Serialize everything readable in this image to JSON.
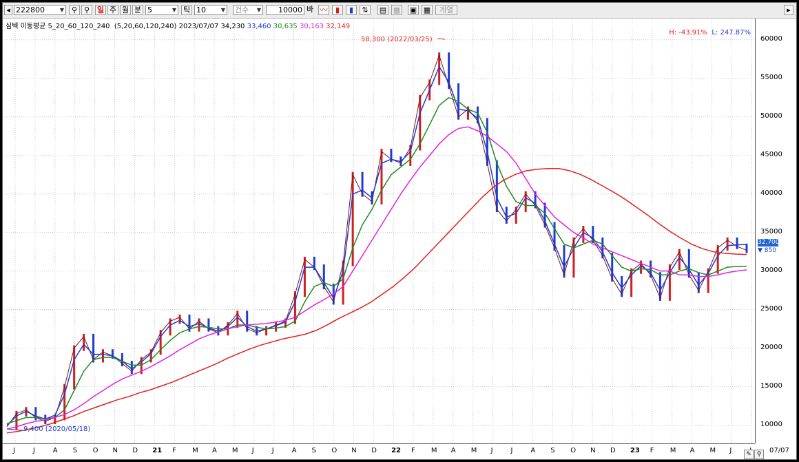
{
  "toolbar": {
    "code": "222800",
    "period_buttons": [
      "일",
      "주",
      "월",
      "분"
    ],
    "minute_value": "5",
    "tick_label": "틱",
    "tick_value": "10",
    "count_label": "건수",
    "count_value": "10000",
    "bar_label": "바",
    "extra_button": "계열"
  },
  "header": {
    "indicator": "심텍 이동평균 5_20_60_120_240",
    "params": "(5,20,60,120,240)",
    "date_close": "2023/07/07 34,230",
    "ma_values": [
      {
        "text": "33,460",
        "color": "#1e3cd2"
      },
      {
        "text": "30,635",
        "color": "#1e8a1e"
      },
      {
        "text": "30,163",
        "color": "#e61ee6"
      },
      {
        "text": "32,149",
        "color": "#e61e1e"
      }
    ]
  },
  "hl": {
    "high": "H: -43.91%",
    "low": "L: 247.87%"
  },
  "annotations": {
    "max_label": "58,300 (2022/03/25)",
    "min_label": "9,400 (2020/05/18)"
  },
  "current": {
    "price": "32,700",
    "change": "▼ 850",
    "last_date": "07/07"
  },
  "yticks": [
    "60000",
    "55000",
    "50000",
    "45000",
    "40000",
    "35000",
    "30000",
    "25000",
    "20000",
    "15000",
    "10000"
  ],
  "xticks": [
    {
      "t": "J",
      "b": false
    },
    {
      "t": "J",
      "b": false
    },
    {
      "t": "A",
      "b": false
    },
    {
      "t": "S",
      "b": false
    },
    {
      "t": "O",
      "b": false
    },
    {
      "t": "N",
      "b": false
    },
    {
      "t": "D",
      "b": false
    },
    {
      "t": "21",
      "b": true
    },
    {
      "t": "F",
      "b": false
    },
    {
      "t": "M",
      "b": false
    },
    {
      "t": "A",
      "b": false
    },
    {
      "t": "M",
      "b": false
    },
    {
      "t": "J",
      "b": false
    },
    {
      "t": "J",
      "b": false
    },
    {
      "t": "A",
      "b": false
    },
    {
      "t": "S",
      "b": false
    },
    {
      "t": "O",
      "b": false
    },
    {
      "t": "N",
      "b": false
    },
    {
      "t": "D",
      "b": false
    },
    {
      "t": "22",
      "b": true
    },
    {
      "t": "F",
      "b": false
    },
    {
      "t": "M",
      "b": false
    },
    {
      "t": "A",
      "b": false
    },
    {
      "t": "M",
      "b": false
    },
    {
      "t": "J",
      "b": false
    },
    {
      "t": "J",
      "b": false
    },
    {
      "t": "A",
      "b": false
    },
    {
      "t": "S",
      "b": false
    },
    {
      "t": "O",
      "b": false
    },
    {
      "t": "N",
      "b": false
    },
    {
      "t": "D",
      "b": false
    },
    {
      "t": "23",
      "b": true
    },
    {
      "t": "F",
      "b": false
    },
    {
      "t": "M",
      "b": false
    },
    {
      "t": "A",
      "b": false
    },
    {
      "t": "M",
      "b": false
    },
    {
      "t": "J",
      "b": false
    },
    {
      "t": "J",
      "b": false
    }
  ],
  "chart_data": {
    "type": "line",
    "ylim": [
      8000,
      61500
    ],
    "series": [
      {
        "name": "close",
        "color": "#d21e1e",
        "values": [
          9800,
          11500,
          12000,
          11000,
          10500,
          11000,
          15000,
          20000,
          21500,
          18500,
          19500,
          19000,
          18000,
          17000,
          18500,
          19500,
          22000,
          23500,
          24000,
          22500,
          23500,
          22500,
          22000,
          23000,
          24500,
          22500,
          22000,
          22500,
          23000,
          23500,
          27000,
          31500,
          30500,
          28000,
          26000,
          31000,
          42500,
          40000,
          39000,
          45500,
          44500,
          44000,
          46000,
          52500,
          54500,
          58000,
          54000,
          50000,
          51000,
          49500,
          44000,
          38000,
          36500,
          38000,
          40000,
          38500,
          36000,
          33000,
          29500,
          34000,
          35500,
          34000,
          32000,
          29000,
          27000,
          30000,
          31000,
          29500,
          26500,
          30500,
          32500,
          29500,
          27500,
          30000,
          33000,
          34000,
          33200,
          32700
        ]
      },
      {
        "name": "MA5",
        "color": "#1e3cd2",
        "values": [
          10000,
          11200,
          11800,
          11200,
          10800,
          11300,
          14000,
          18500,
          20500,
          19200,
          19200,
          19000,
          18300,
          17300,
          18200,
          19300,
          21500,
          23000,
          23600,
          22800,
          23200,
          22600,
          22200,
          22800,
          24000,
          22800,
          22200,
          22500,
          22900,
          23400,
          26000,
          30500,
          30500,
          28500,
          26500,
          30000,
          40000,
          40500,
          39500,
          44000,
          44500,
          44200,
          45500,
          50500,
          53500,
          56500,
          54500,
          51000,
          50800,
          49800,
          45500,
          39500,
          37000,
          37500,
          39500,
          38800,
          36500,
          33500,
          30500,
          33000,
          35000,
          34300,
          32500,
          29800,
          27800,
          29500,
          30700,
          29800,
          27500,
          29800,
          31800,
          30200,
          28200,
          29700,
          32000,
          33300,
          33400,
          33460
        ]
      },
      {
        "name": "MA20",
        "color": "#1e8a1e",
        "values": [
          10200,
          10600,
          11000,
          11000,
          10800,
          11000,
          12000,
          14500,
          17000,
          18500,
          18800,
          18800,
          18300,
          17800,
          17800,
          18500,
          19800,
          21000,
          22000,
          22500,
          22800,
          22700,
          22500,
          22500,
          23000,
          23000,
          22700,
          22500,
          22600,
          22800,
          23500,
          26000,
          28000,
          28500,
          28000,
          29000,
          33000,
          36000,
          38000,
          40500,
          42500,
          43500,
          44500,
          46500,
          49000,
          51500,
          52500,
          52000,
          51000,
          50500,
          48000,
          44000,
          41000,
          39000,
          38500,
          38500,
          37500,
          35500,
          33500,
          33000,
          33500,
          34000,
          33500,
          32000,
          30500,
          30000,
          30300,
          30200,
          29500,
          29500,
          30000,
          30300,
          29800,
          29500,
          30000,
          30500,
          30600,
          30635
        ]
      },
      {
        "name": "MA60",
        "color": "#e61ee6",
        "values": [
          9500,
          9800,
          10200,
          10500,
          10700,
          11000,
          11400,
          12000,
          12800,
          13700,
          14500,
          15300,
          16000,
          16500,
          17000,
          17600,
          18300,
          19000,
          19800,
          20500,
          21200,
          21700,
          22100,
          22500,
          22800,
          23000,
          23100,
          23200,
          23400,
          23600,
          24000,
          24800,
          25600,
          26300,
          27000,
          28000,
          30000,
          32000,
          34000,
          36000,
          38000,
          40000,
          41800,
          43500,
          45000,
          46500,
          47700,
          48500,
          48700,
          48200,
          47500,
          46500,
          45500,
          44000,
          42000,
          40000,
          38500,
          37000,
          36000,
          35000,
          34300,
          33500,
          33000,
          32500,
          32000,
          31500,
          31000,
          30500,
          30000,
          30000,
          29500,
          29500,
          29300,
          29300,
          29500,
          29800,
          30000,
          30163
        ]
      },
      {
        "name": "MA120",
        "color": "#e61e1e",
        "values": [
          9000,
          9200,
          9500,
          9800,
          10200,
          10700,
          11200,
          11800,
          12300,
          12800,
          13300,
          13700,
          14200,
          14600,
          15100,
          15600,
          16200,
          16800,
          17400,
          18000,
          18700,
          19300,
          19900,
          20400,
          20800,
          21200,
          21500,
          21800,
          22300,
          23000,
          23800,
          24500,
          25200,
          26000,
          27000,
          28000,
          29200,
          30500,
          32000,
          33500,
          35000,
          36500,
          38000,
          39500,
          40800,
          41800,
          42500,
          43000,
          43200,
          43300,
          43300,
          43000,
          42500,
          41800,
          41000,
          40200,
          39300,
          38300,
          37300,
          36200,
          35200,
          34300,
          33500,
          32900,
          32500,
          32300,
          32200,
          32149
        ]
      }
    ]
  }
}
